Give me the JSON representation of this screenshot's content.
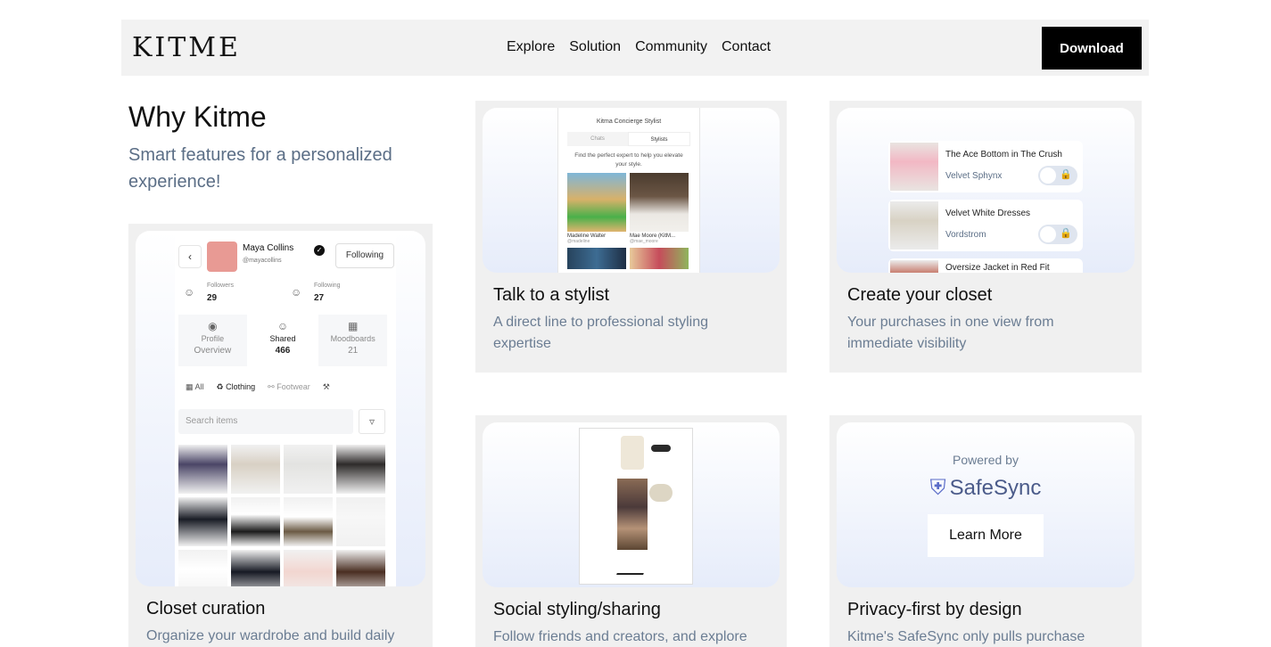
{
  "header": {
    "logo": "KITME",
    "nav": [
      "Explore",
      "Solution",
      "Community",
      "Contact"
    ],
    "download_label": "Download"
  },
  "intro": {
    "title": "Why Kitme",
    "subtitle": "Smart features for a personalized experience!"
  },
  "cards": {
    "stylist": {
      "title": "Talk to a stylist",
      "desc": "A direct line to professional styling expertise",
      "mock": {
        "app_title": "Kitma Concierge Stylist",
        "tabs": [
          "Chats",
          "Stylists"
        ],
        "desc": "Find the perfect expert to help you elevate your style.",
        "names": [
          "Madeline Walter",
          "Mae Moore (KitM..."
        ],
        "handles": [
          "@madeline",
          "@mae_moore"
        ]
      }
    },
    "closet": {
      "title": "Create your closet",
      "desc": "Your purchases in one view from immediate visibility",
      "items": [
        {
          "name": "The Ace Bottom in The Crush",
          "brand": "Velvet Sphynx"
        },
        {
          "name": "Velvet White Dresses",
          "brand": "Vordstrom"
        },
        {
          "name": "Oversize Jacket in Red Fit",
          "brand": ""
        }
      ]
    },
    "curation": {
      "title": "Closet curation",
      "desc": "Organize your wardrobe and build daily",
      "profile": {
        "name": "Maya Collins",
        "handle": "@mayacollins",
        "follow_label": "Following",
        "followers_label": "Followers",
        "followers": "29",
        "following_label": "Following",
        "following": "27",
        "tiles": [
          {
            "label": "Profile",
            "value": "Overview"
          },
          {
            "label": "Shared",
            "value": "466"
          },
          {
            "label": "Moodboards",
            "value": "21"
          }
        ],
        "filters": [
          "All",
          "Clothing",
          "Footwear"
        ],
        "search_placeholder": "Search items"
      }
    },
    "social": {
      "title": "Social styling/sharing",
      "desc": "Follow friends and creators, and explore"
    },
    "privacy": {
      "title": "Privacy-first by design",
      "desc": "Kitme's SafeSync only pulls purchase",
      "powered_by": "Powered by",
      "brand": "SafeSync",
      "learn_more": "Learn More"
    }
  }
}
